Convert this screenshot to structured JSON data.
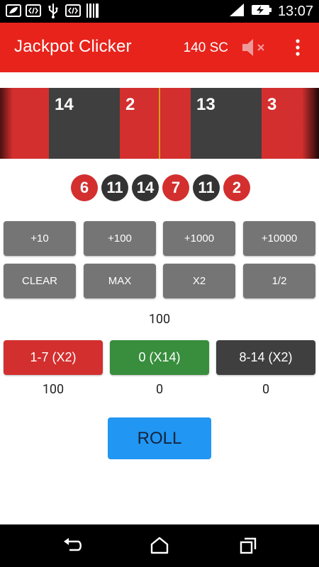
{
  "status_bar": {
    "time": "13:07",
    "left_icons": [
      "leaf-icon",
      "code-icon",
      "usb-icon",
      "code-icon",
      "barcode-icon"
    ],
    "right_icons": [
      "signal-icon",
      "battery-charging-icon"
    ]
  },
  "app_bar": {
    "title": "Jackpot Clicker",
    "balance": "140 SC",
    "icons": [
      "volume-mute-icon",
      "overflow-menu-icon"
    ]
  },
  "wheel": {
    "segments": [
      {
        "number": "",
        "color": "red"
      },
      {
        "number": "14",
        "color": "dark"
      },
      {
        "number": "2",
        "color": "red"
      },
      {
        "number": "13",
        "color": "dark"
      },
      {
        "number": "3",
        "color": "red"
      }
    ]
  },
  "history": [
    {
      "value": "6",
      "color": "red"
    },
    {
      "value": "11",
      "color": "dark"
    },
    {
      "value": "14",
      "color": "dark"
    },
    {
      "value": "7",
      "color": "red"
    },
    {
      "value": "11",
      "color": "dark"
    },
    {
      "value": "2",
      "color": "red"
    }
  ],
  "bet_buttons": {
    "row1": [
      "+10",
      "+100",
      "+1000",
      "+10000"
    ],
    "row2": [
      "CLEAR",
      "MAX",
      "X2",
      "1/2"
    ]
  },
  "bet_amount": "100",
  "picks": [
    {
      "label": "1-7 (X2)",
      "total": "100",
      "color": "#d32f2f"
    },
    {
      "label": "0 (X14)",
      "total": "0",
      "color": "#388e3c"
    },
    {
      "label": "8-14 (X2)",
      "total": "0",
      "color": "#3f3f3f"
    }
  ],
  "roll_label": "ROLL",
  "nav_bar": {
    "icons": [
      "back-icon",
      "home-icon",
      "recents-icon"
    ]
  },
  "colors": {
    "accent": "#e8231b",
    "red": "#d32f2f",
    "dark": "#3f3f3f",
    "green": "#388e3c",
    "roll": "#2196f3",
    "marker": "#d4a017"
  }
}
